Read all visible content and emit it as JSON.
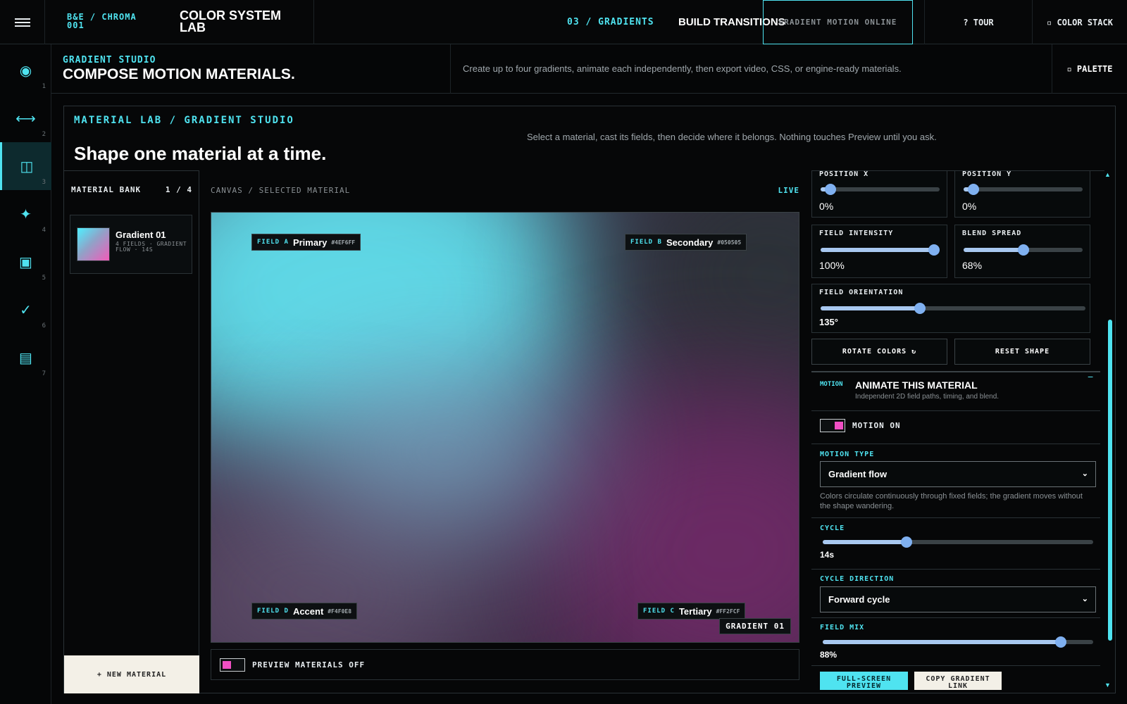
{
  "topbar": {
    "brand_code_line1": "B&E / CHROMA",
    "brand_code_line2": "001",
    "brand_title": "COLOR SYSTEM LAB",
    "step": "03 / GRADIENTS",
    "step_title": "BUILD TRANSITIONS",
    "status": "GRADIENT MOTION ONLINE",
    "tour": "? TOUR",
    "stack": "▫ COLOR STACK"
  },
  "rail": {
    "items": [
      {
        "num": "1",
        "icon": "target-icon",
        "glyph": "◉"
      },
      {
        "num": "2",
        "icon": "arrows-horizontal-icon",
        "glyph": "⟷"
      },
      {
        "num": "3",
        "icon": "columns-icon",
        "glyph": "◫"
      },
      {
        "num": "4",
        "icon": "sparkle-icon",
        "glyph": "✦"
      },
      {
        "num": "5",
        "icon": "square-icon",
        "glyph": "▣"
      },
      {
        "num": "6",
        "icon": "check-icon",
        "glyph": "✓"
      },
      {
        "num": "7",
        "icon": "list-icon",
        "glyph": "▤"
      }
    ],
    "active_index": 2
  },
  "studio": {
    "kicker": "GRADIENT STUDIO",
    "title": "COMPOSE MOTION MATERIALS.",
    "description": "Create up to four gradients, animate each independently, then export video, CSS, or engine-ready materials.",
    "palette_button": "▫ PALETTE"
  },
  "panel": {
    "kicker": "MATERIAL LAB / GRADIENT STUDIO",
    "title": "Shape one material at a time.",
    "description": "Select a material, cast its fields, then decide where it belongs. Nothing touches Preview until you ask."
  },
  "bank": {
    "title": "MATERIAL BANK",
    "count": "1 / 4",
    "card": {
      "title": "Gradient 01",
      "meta": "4 FIELDS · GRADIENT FLOW · 14S"
    },
    "new_button": "+ NEW MATERIAL"
  },
  "canvas": {
    "label": "CANVAS / SELECTED MATERIAL",
    "live": "LIVE",
    "fields": [
      {
        "letter": "FIELD A",
        "name": "Primary",
        "hex": "#4EF6FF"
      },
      {
        "letter": "FIELD B",
        "name": "Secondary",
        "hex": "#050505"
      },
      {
        "letter": "FIELD C",
        "name": "Tertiary",
        "hex": "#FF2FCF"
      },
      {
        "letter": "FIELD D",
        "name": "Accent",
        "hex": "#F4F0E8"
      }
    ],
    "gradient_tag": "GRADIENT 01",
    "preview_label": "PREVIEW MATERIALS OFF"
  },
  "controls": {
    "position_x": {
      "label": "POSITION X",
      "value": "0%",
      "level": 0.08
    },
    "position_y": {
      "label": "POSITION Y",
      "value": "0%",
      "level": 0.08
    },
    "intensity": {
      "label": "FIELD INTENSITY",
      "value": "100%",
      "level": 1.0
    },
    "blend_spread": {
      "label": "BLEND SPREAD",
      "value": "68%",
      "level": 0.5
    },
    "orientation": {
      "label": "FIELD ORIENTATION",
      "value": "135°",
      "level": 0.375
    },
    "rotate_button": "ROTATE COLORS ↻",
    "reset_button": "RESET SHAPE"
  },
  "motion": {
    "tag": "MOTION",
    "title": "ANIMATE THIS MATERIAL",
    "subtitle": "Independent 2D field paths, timing, and blend.",
    "collapse": "−",
    "toggle_label": "MOTION ON",
    "type_label": "MOTION TYPE",
    "type_value": "Gradient flow",
    "type_help": "Colors circulate continuously through fixed fields; the gradient moves without the shape wandering.",
    "cycle_label": "CYCLE",
    "cycle_value": "14s",
    "cycle_level": 0.31,
    "direction_label": "CYCLE DIRECTION",
    "direction_value": "Forward cycle",
    "mix_label": "FIELD MIX",
    "mix_value": "88%",
    "mix_level": 0.88,
    "fullscreen_button": "FULL-SCREEN PREVIEW",
    "copy_button": "COPY GRADIENT LINK"
  },
  "colors": {
    "accent": "#4fe3f0",
    "pink": "#f04fc4",
    "slider": "#a8c8f0"
  }
}
